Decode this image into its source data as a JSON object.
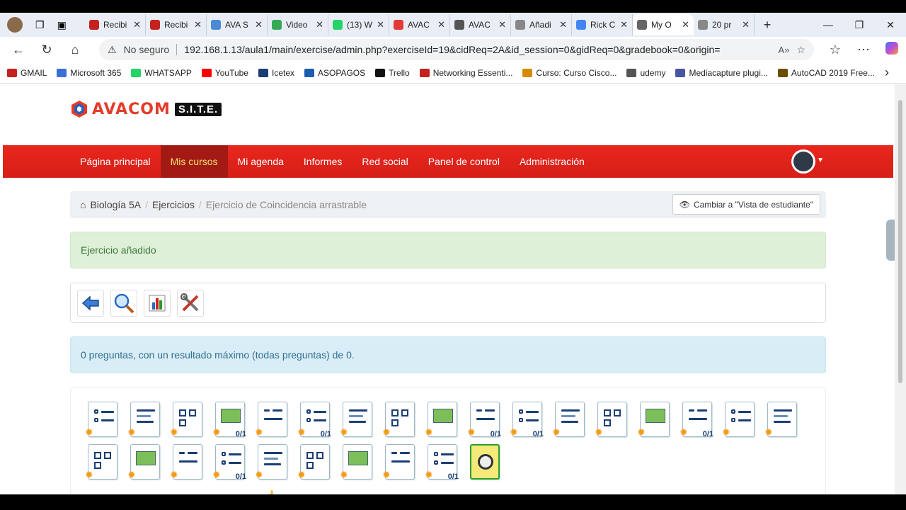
{
  "browser": {
    "tabs": [
      {
        "label": "Recibi",
        "color": "#c5221f"
      },
      {
        "label": "Recibi",
        "color": "#c5221f"
      },
      {
        "label": "AVA S",
        "color": "#4a8ad4"
      },
      {
        "label": "Video",
        "color": "#34a853"
      },
      {
        "label": "(13) W",
        "color": "#25d366"
      },
      {
        "label": "AVAC",
        "color": "#e53935"
      },
      {
        "label": "AVAC",
        "color": "#555"
      },
      {
        "label": "Añadi",
        "color": "#888"
      },
      {
        "label": "Rick C",
        "color": "#4285f4"
      },
      {
        "label": "My O",
        "color": "#666"
      },
      {
        "label": "20 pr",
        "color": "#888"
      }
    ],
    "active_tab_index": 9,
    "not_secure": "No seguro",
    "url": "192.168.1.13/aula1/main/exercise/admin.php?exerciseId=19&cidReq=2A&id_session=0&gidReq=0&gradebook=0&origin=",
    "bookmarks": [
      {
        "label": "GMAIL",
        "color": "#c5221f"
      },
      {
        "label": "Microsoft 365",
        "color": "#3a6fd8"
      },
      {
        "label": "WHATSAPP",
        "color": "#25d366"
      },
      {
        "label": "YouTube",
        "color": "#ff0000"
      },
      {
        "label": "Icetex",
        "color": "#1b3f74"
      },
      {
        "label": "ASOPAGOS",
        "color": "#1b5cb0"
      },
      {
        "label": "Trello",
        "color": "#111"
      },
      {
        "label": "Networking Essenti...",
        "color": "#c5221f"
      },
      {
        "label": "Curso: Curso Cisco...",
        "color": "#d68a00"
      },
      {
        "label": "udemy",
        "color": "#555"
      },
      {
        "label": "Mediacapture plugi...",
        "color": "#4a55a2"
      },
      {
        "label": "AutoCAD 2019 Free...",
        "color": "#6b4f00"
      }
    ]
  },
  "site": {
    "logo_name": "AVACOM",
    "logo_site": "S.I.T.E.",
    "nav": [
      {
        "label": "Página principal",
        "active": false
      },
      {
        "label": "Mis cursos",
        "active": true
      },
      {
        "label": "Mi agenda",
        "active": false
      },
      {
        "label": "Informes",
        "active": false
      },
      {
        "label": "Red social",
        "active": false
      },
      {
        "label": "Panel de control",
        "active": false
      },
      {
        "label": "Administración",
        "active": false
      }
    ],
    "breadcrumb": {
      "course": "Biología 5A",
      "section": "Ejercicios",
      "current": "Ejercicio de Coincidencia arrastrable"
    },
    "student_view_button": "Cambiar a \"Vista de estudiante\"",
    "alert_success": "Ejercicio añadido",
    "alert_info": "0 preguntas, con un resultado máximo (todas preguntas) de 0.",
    "toolbar_icons": [
      "back-arrow-icon",
      "preview-magnifier-icon",
      "results-chart-icon",
      "settings-tools-icon"
    ],
    "question_types": [
      {
        "icon": "unique-answer-icon",
        "badge": ""
      },
      {
        "icon": "multiple-answer-icon",
        "badge": ""
      },
      {
        "icon": "fill-blanks-icon",
        "badge": ""
      },
      {
        "icon": "fill-blanks-combination-icon",
        "badge": "0/1"
      },
      {
        "icon": "matching-icon",
        "badge": ""
      },
      {
        "icon": "matching-combination-icon",
        "badge": "0/1"
      },
      {
        "icon": "open-question-icon",
        "badge": ""
      },
      {
        "icon": "oral-expression-icon",
        "badge": ""
      },
      {
        "icon": "hotspot-icon",
        "badge": ""
      },
      {
        "icon": "hotspot-combination-icon",
        "badge": "0/1"
      },
      {
        "icon": "unique-answer-no-option-icon",
        "badge": "0/1"
      },
      {
        "icon": "true-false-icon",
        "badge": ""
      },
      {
        "icon": "multiple-choice-true-false-icon",
        "badge": ""
      },
      {
        "icon": "certainty-degree-icon",
        "badge": ""
      },
      {
        "icon": "multiple-answer-combination-true-false-icon",
        "badge": "0/1"
      },
      {
        "icon": "global-multiple-answer-icon",
        "badge": ""
      },
      {
        "icon": "calculated-answer-icon",
        "badge": ""
      },
      {
        "icon": "unique-answer-image-icon",
        "badge": ""
      },
      {
        "icon": "drag-and-drop-icon",
        "badge": ""
      },
      {
        "icon": "match-drag-icon",
        "badge": ""
      },
      {
        "icon": "match-drag-combination-icon",
        "badge": "0/1"
      },
      {
        "icon": "annotation-icon",
        "badge": ""
      },
      {
        "icon": "reading-comprehension-icon",
        "badge": ""
      },
      {
        "icon": "upload-answer-icon",
        "badge": ""
      },
      {
        "icon": "page-break-icon",
        "badge": ""
      },
      {
        "icon": "multiple-answer-dropdown-combination-icon",
        "badge": "0/1"
      },
      {
        "icon": "question-bank-safe-icon",
        "badge": "",
        "highlight": true
      }
    ]
  }
}
